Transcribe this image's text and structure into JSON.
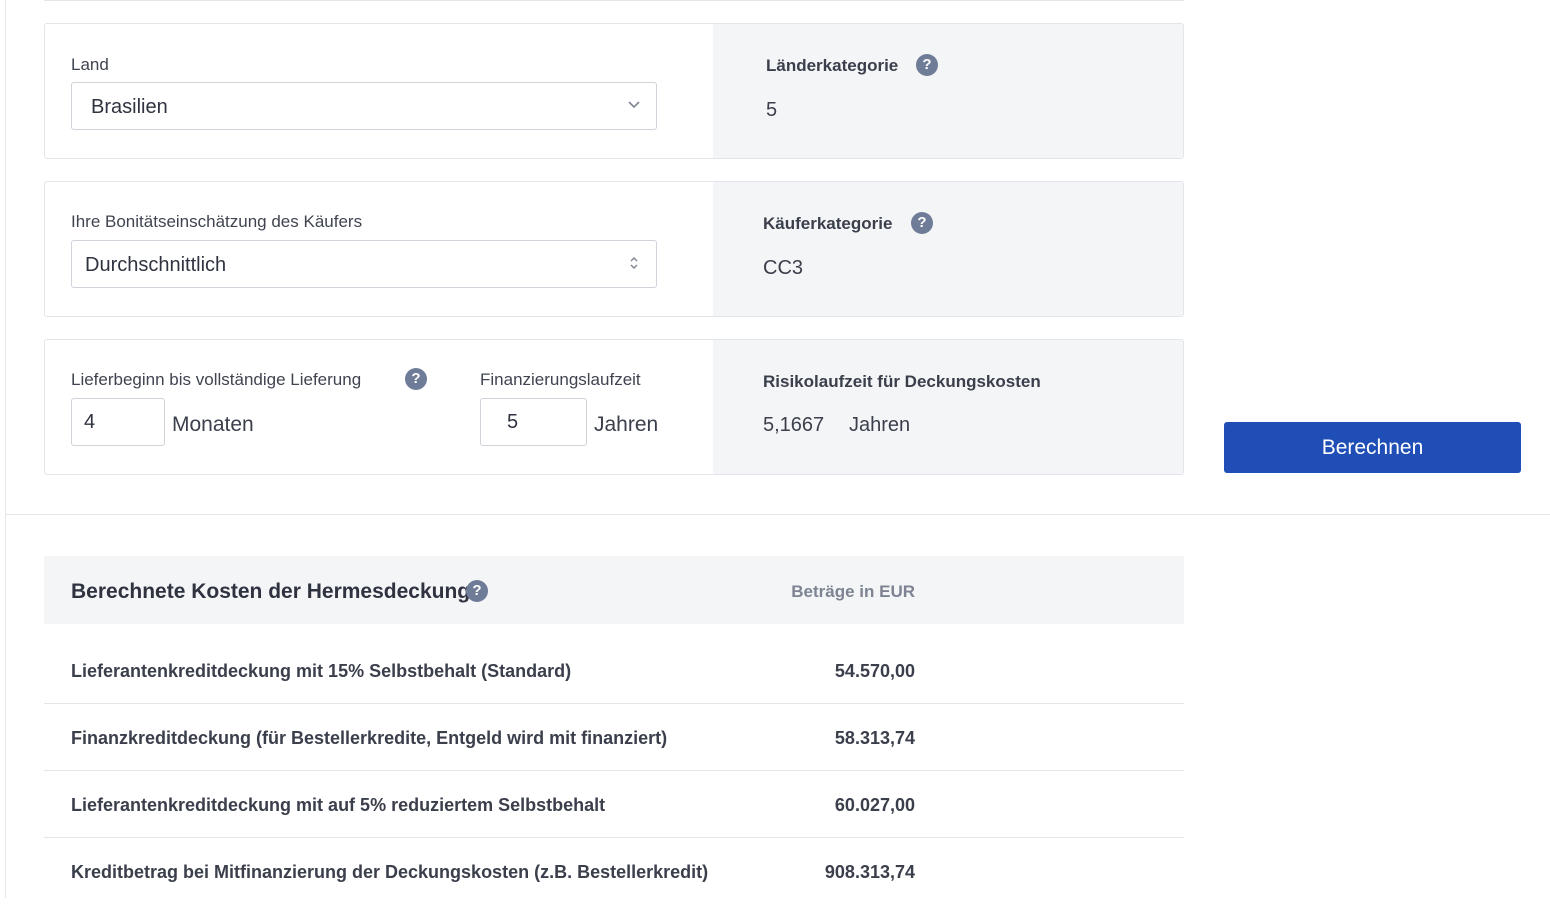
{
  "country": {
    "label": "Land",
    "value": "Brasilien",
    "category_label": "Länderkategorie",
    "category_value": "5"
  },
  "buyer": {
    "label": "Ihre Bonitätseinschätzung des Käufers",
    "value": "Durchschnittlich",
    "category_label": "Käuferkategorie",
    "category_value": "CC3"
  },
  "term": {
    "delivery_label": "Lieferbeginn bis vollständige Lieferung",
    "delivery_value": "4",
    "delivery_unit": "Monaten",
    "financing_label": "Finanzierungslaufzeit",
    "financing_value": "5",
    "financing_unit": "Jahren",
    "risk_label": "Risikolaufzeit für Deckungskosten",
    "risk_value": "5,1667",
    "risk_unit": "Jahren"
  },
  "help_glyph": "?",
  "calculate_button": "Berechnen",
  "results": {
    "title": "Berechnete Kosten der Hermesdeckung",
    "unit_header": "Beträge in EUR",
    "rows": [
      {
        "label": "Lieferantenkreditdeckung mit 15% Selbstbehalt (Standard)",
        "amount": "54.570,00"
      },
      {
        "label": "Finanzkreditdeckung (für Bestellerkredite, Entgeld wird mit finanziert)",
        "amount": "58.313,74"
      },
      {
        "label": "Lieferantenkreditdeckung mit auf 5% reduziertem Selbstbehalt",
        "amount": "60.027,00"
      },
      {
        "label": "Kreditbetrag bei Mitfinanzierung der Deckungskosten (z.B. Bestellerkredit)",
        "amount": "908.313,74"
      }
    ]
  },
  "colors": {
    "primary_button": "#1f4fb6",
    "help_icon": "#6f7c97",
    "info_panel": "#f4f5f7"
  },
  "icons": {
    "help": "question-circle-icon",
    "select_chevron": "chevron-down-icon",
    "select_sort": "sort-arrows-icon"
  }
}
